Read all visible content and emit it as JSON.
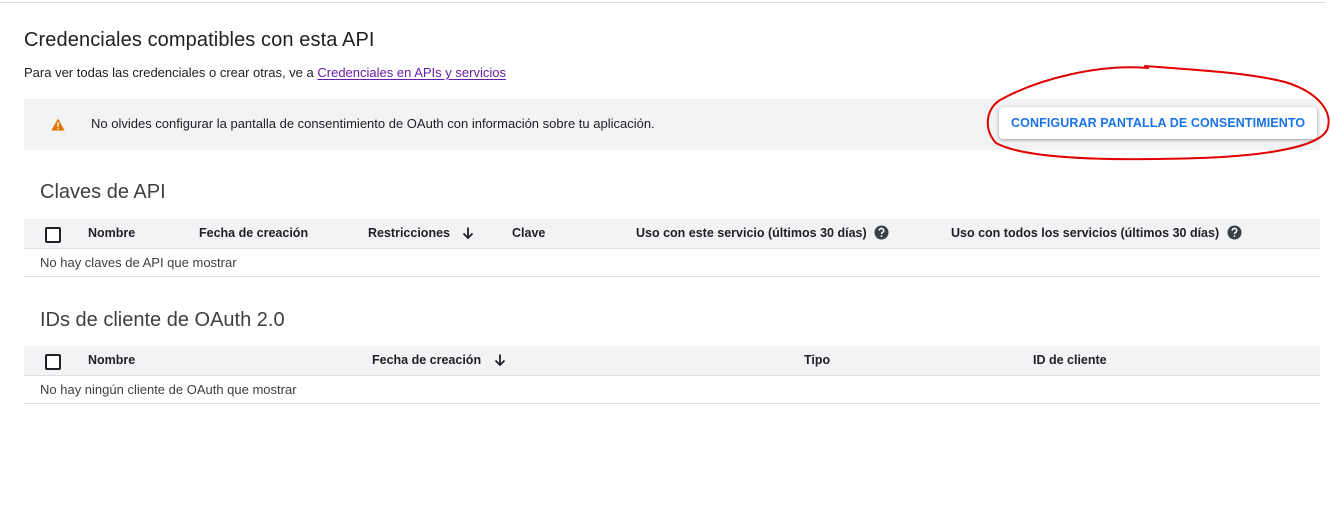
{
  "header": {
    "title": "Credenciales compatibles con esta API",
    "subtitle_prefix": "Para ver todas las credenciales o crear otras, ve a ",
    "subtitle_link": "Credenciales en APIs y servicios"
  },
  "banner": {
    "icon": "warning-icon",
    "message": "No olvides configurar la pantalla de consentimiento de OAuth con información sobre tu aplicación.",
    "button_label": "CONFIGURAR PANTALLA DE CONSENTIMIENTO"
  },
  "api_keys": {
    "title": "Claves de API",
    "columns": {
      "name": "Nombre",
      "created": "Fecha de creación",
      "restrictions": "Restricciones",
      "key": "Clave",
      "usage_service": "Uso con este servicio (últimos 30 días)",
      "usage_all": "Uso con todos los servicios (últimos 30 días)"
    },
    "empty_text": "No hay claves de API que mostrar"
  },
  "oauth": {
    "title": "IDs de cliente de OAuth 2.0",
    "columns": {
      "name": "Nombre",
      "created": "Fecha de creación",
      "type": "Tipo",
      "client_id": "ID de cliente"
    },
    "empty_text": "No hay ningún cliente de OAuth que mostrar"
  },
  "colors": {
    "accent": "#1a73e8",
    "link": "#681da8",
    "warning": "#e37400",
    "annotation": "#e00000",
    "header_bg": "#f1f3f4"
  }
}
